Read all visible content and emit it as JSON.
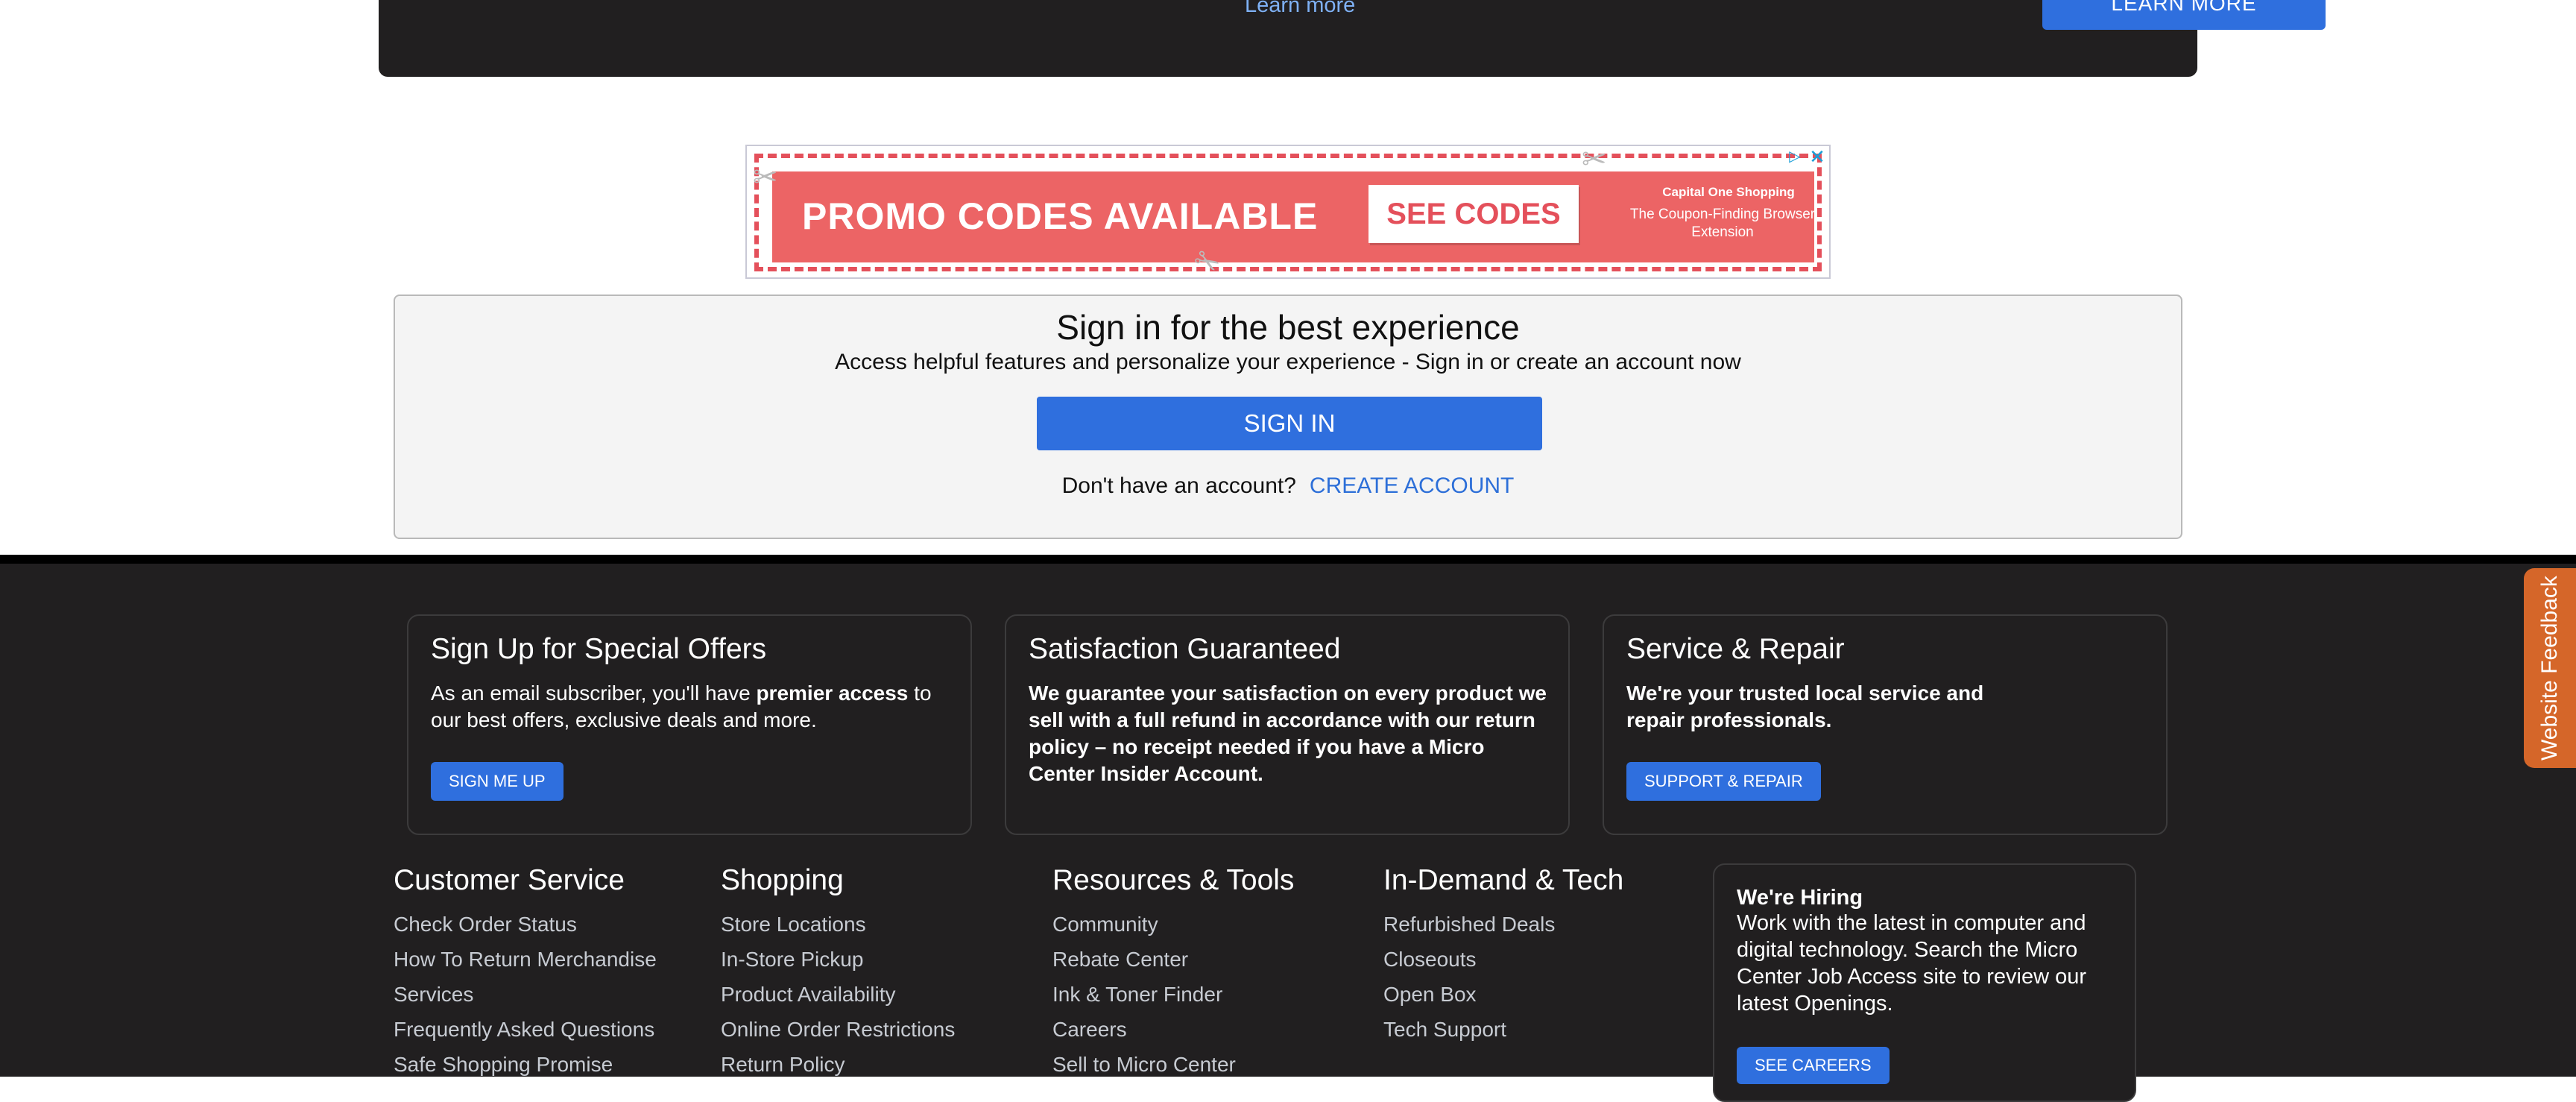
{
  "top_banner": {
    "learn_more_link": "Learn more",
    "learn_more_button": "LEARN MORE"
  },
  "ad": {
    "headline": "PROMO CODES AVAILABLE",
    "cta": "SEE CODES",
    "brand": "Capital One Shopping",
    "subtext": "The Coupon-Finding Browser Extension",
    "choices_icon": "ad-choices-icon",
    "close_icon": "close-icon",
    "colors": {
      "background": "#ec6465",
      "dash": "#e4505b"
    }
  },
  "signin": {
    "title": "Sign in for the best experience",
    "subtitle": "Access helpful features and personalize your experience - Sign in or create an account now",
    "button": "SIGN IN",
    "no_account": "Don't have an account?",
    "create_account": "CREATE ACCOUNT"
  },
  "promos": [
    {
      "title": "Sign Up for Special Offers",
      "text_before": "As an email subscriber, you'll have ",
      "text_bold": "premier access",
      "text_after": " to our best offers, exclusive deals and more.",
      "button": "SIGN ME UP"
    },
    {
      "title": "Satisfaction Guaranteed",
      "text": "We guarantee your satisfaction on every product we sell with a full refund in accordance with our return policy – no receipt needed if you have a Micro Center Insider Account."
    },
    {
      "title": "Service & Repair",
      "text": "We're your trusted local service and repair professionals.",
      "button": "SUPPORT & REPAIR"
    }
  ],
  "footer_columns": [
    {
      "title": "Customer Service",
      "links": [
        "Check Order Status",
        "How To Return Merchandise",
        "Services",
        "Frequently Asked Questions",
        "Safe Shopping Promise"
      ]
    },
    {
      "title": "Shopping",
      "links": [
        "Store Locations",
        "In-Store Pickup",
        "Product Availability",
        "Online Order Restrictions",
        "Return Policy"
      ]
    },
    {
      "title": "Resources & Tools",
      "links": [
        "Community",
        "Rebate Center",
        "Ink & Toner Finder",
        "Careers",
        "Sell to Micro Center"
      ]
    },
    {
      "title": "In-Demand & Tech",
      "links": [
        "Refurbished Deals",
        "Closeouts",
        "Open Box",
        "Tech Support"
      ]
    }
  ],
  "hiring": {
    "title": "We're Hiring",
    "text": "Work with the latest in computer and digital technology. Search the Micro Center Job Access site to review our latest Openings.",
    "button": "SEE CAREERS"
  },
  "feedback_tab": "Website Feedback",
  "colors": {
    "footer_bg": "#211f20",
    "accent_blue": "#2f6fde",
    "feedback_orange": "#d56629"
  }
}
